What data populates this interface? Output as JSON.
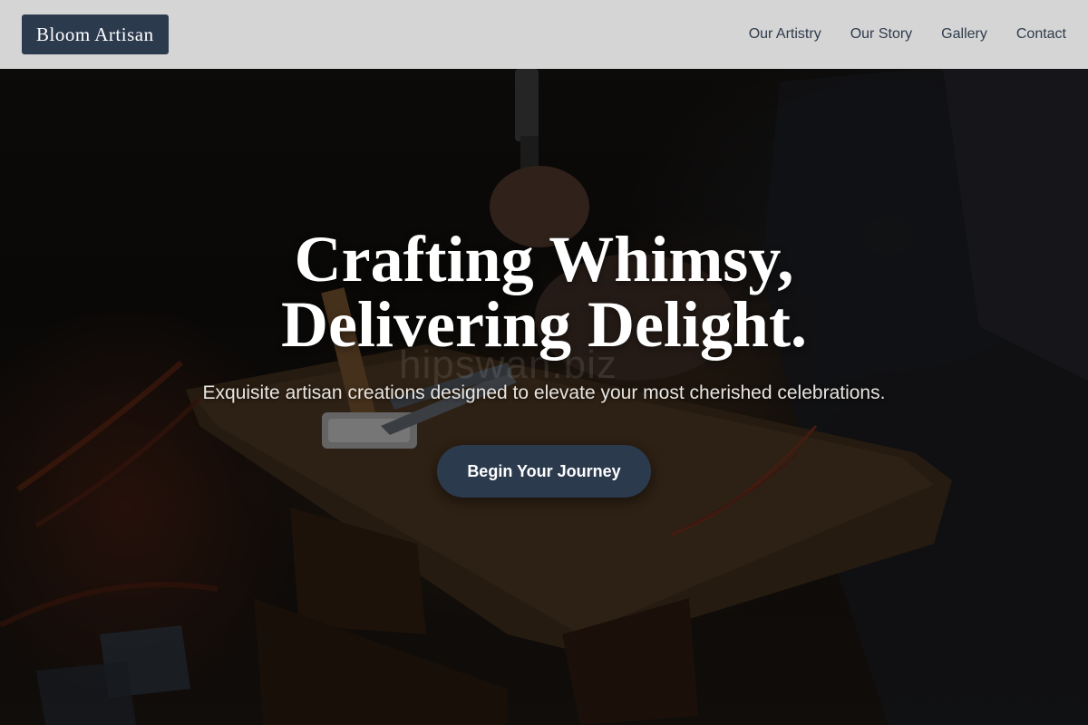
{
  "header": {
    "logo": "Bloom Artisan",
    "nav": [
      {
        "label": "Our Artistry"
      },
      {
        "label": "Our Story"
      },
      {
        "label": "Gallery"
      },
      {
        "label": "Contact"
      }
    ]
  },
  "hero": {
    "headline_line1": "Crafting Whimsy,",
    "headline_line2": "Delivering Delight.",
    "subtitle": "Exquisite artisan creations designed to elevate your most cherished celebrations.",
    "cta_label": "Begin Your Journey",
    "watermark": "hipswan.biz",
    "background_image": "artisan-workbench-with-hammer-and-tools"
  },
  "colors": {
    "brand_navy": "#2c3a4e",
    "header_bg": "#dcdcdc",
    "nav_text": "#2f3b4c",
    "hero_text": "#ffffff"
  }
}
